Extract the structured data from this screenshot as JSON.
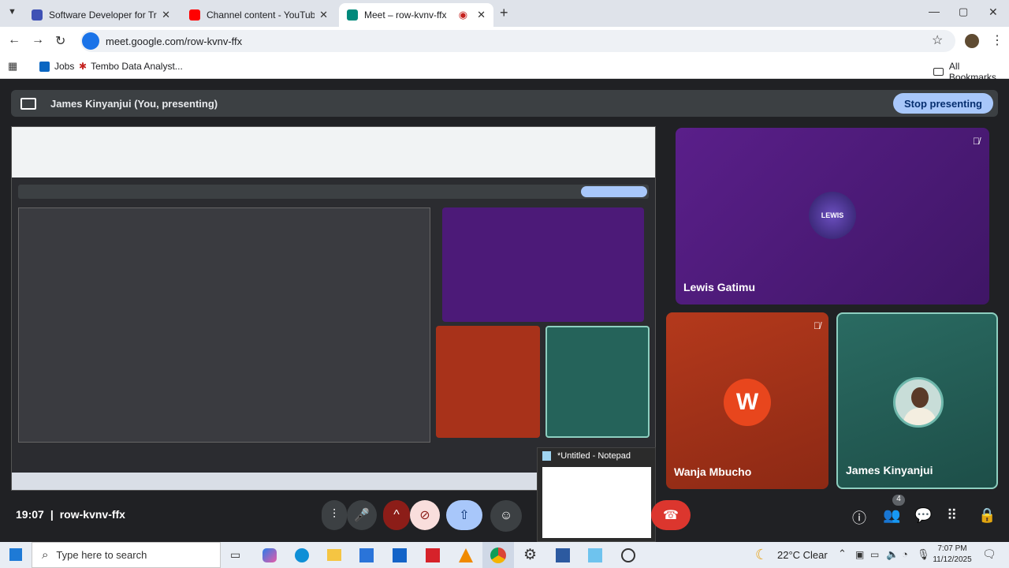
{
  "browser": {
    "tabs": [
      {
        "title": "Software Developer for Training",
        "color": "#3f51b5"
      },
      {
        "title": "Channel content - YouTube Stu",
        "color": "#ff0000"
      },
      {
        "title": "Meet – row-kvnv-ffx",
        "color": "#00897b"
      }
    ],
    "url": "meet.google.com/row-kvnv-ffx",
    "bookmarks": [
      {
        "label": "Jobs"
      },
      {
        "label": "Tembo Data Analyst..."
      }
    ],
    "all_bookmarks": "All Bookmarks"
  },
  "meet": {
    "presenting_label": "James Kinyanjui (You, presenting)",
    "stop_label": "Stop presenting",
    "participants": [
      {
        "name": "Lewis Gatimu",
        "avatar": "LEWIS"
      },
      {
        "name": "Wanja Mbucho",
        "avatar": "W"
      },
      {
        "name": "James Kinyanjui"
      }
    ],
    "time": "19:07",
    "separator": "|",
    "meeting_code": "row-kvnv-ffx",
    "people_count": "4",
    "notepad_title": "*Untitled - Notepad"
  },
  "taskbar": {
    "search_placeholder": "Type here to search",
    "weather": "22°C  Clear",
    "clock_time": "7:07 PM",
    "clock_date": "11/12/2025"
  },
  "colors": {
    "accent": "#a8c7fa",
    "lewis_tile": "#4c1a78",
    "wanja_tile": "#a8321a",
    "james_tile": "#25635a",
    "end_call": "#ea4335"
  }
}
